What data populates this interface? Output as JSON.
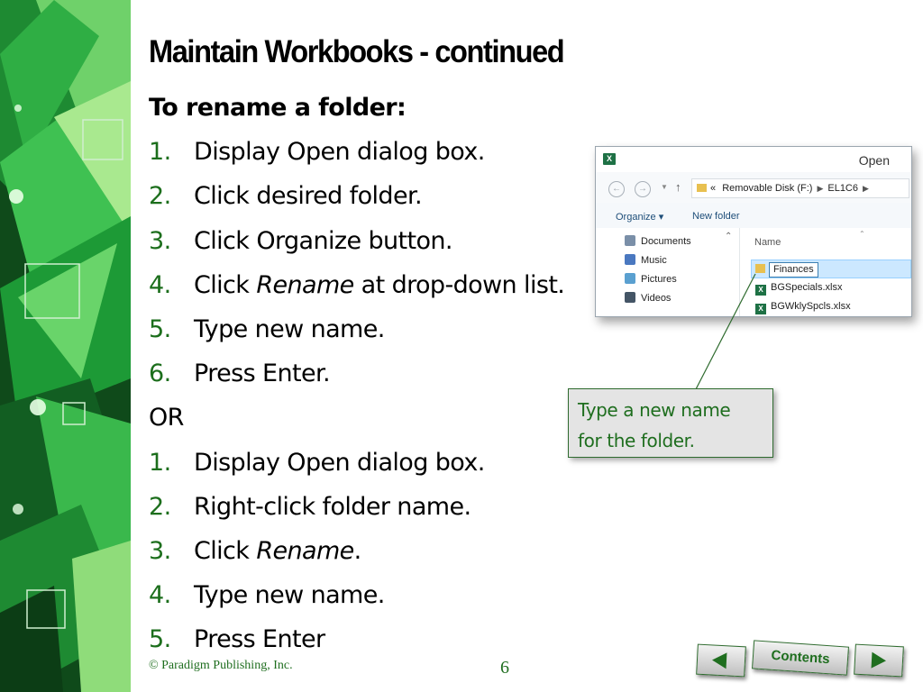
{
  "slide": {
    "title": "Maintain Workbooks - continued",
    "heading": "To rename a folder:",
    "steps_a": [
      {
        "num": "1.",
        "pre": "Display Open dialog box.",
        "em": "",
        "post": ""
      },
      {
        "num": "2.",
        "pre": "Click desired folder.",
        "em": "",
        "post": ""
      },
      {
        "num": "3.",
        "pre": "Click Organize button.",
        "em": "",
        "post": ""
      },
      {
        "num": "4.",
        "pre": "Click ",
        "em": "Rename",
        "post": " at drop-down list."
      },
      {
        "num": "5.",
        "pre": "Type new name.",
        "em": "",
        "post": ""
      },
      {
        "num": "6.",
        "pre": "Press Enter.",
        "em": "",
        "post": ""
      }
    ],
    "or_label": "OR",
    "steps_b": [
      {
        "num": "1.",
        "pre": "Display Open dialog box.",
        "em": "",
        "post": ""
      },
      {
        "num": "2.",
        "pre": "Right-click folder name.",
        "em": "",
        "post": ""
      },
      {
        "num": "3.",
        "pre": "Click ",
        "em": "Rename",
        "post": "."
      },
      {
        "num": "4.",
        "pre": "Type new name.",
        "em": "",
        "post": ""
      },
      {
        "num": "5.",
        "pre": "Press Enter",
        "em": "",
        "post": ""
      }
    ]
  },
  "dialog": {
    "app_icon": "excel-icon",
    "title": "Open",
    "back_icon": "back-arrow-icon",
    "forward_icon": "forward-arrow-icon",
    "dropdown_icon": "chevron-down-icon",
    "up_icon": "up-arrow-icon",
    "address": {
      "prefix": "«",
      "drive": "Removable Disk (F:)",
      "folder": "EL1C6"
    },
    "toolbar": {
      "organize": "Organize ▾",
      "new_folder": "New folder"
    },
    "nav_items": [
      {
        "label": "Documents",
        "icon": "documents-icon",
        "color": "#7a8fa8"
      },
      {
        "label": "Music",
        "icon": "music-icon",
        "color": "#4a78c0"
      },
      {
        "label": "Pictures",
        "icon": "pictures-icon",
        "color": "#5aa0d0"
      },
      {
        "label": "Videos",
        "icon": "videos-icon",
        "color": "#445566"
      }
    ],
    "column_header": "Name",
    "files": {
      "editing_folder": "Finances",
      "items": [
        "BGSpecials.xlsx",
        "BGWklySpcls.xlsx"
      ]
    }
  },
  "callout": {
    "line1": "Type a new name",
    "line2": "for the folder."
  },
  "footer": {
    "copyright": "© Paradigm Publishing, Inc.",
    "page": "6",
    "contents_label": "Contents",
    "prev_icon": "previous-arrow-icon",
    "next_icon": "next-arrow-icon"
  },
  "colors": {
    "accent_green": "#1f6e1f",
    "number_green": "#1c6e1c",
    "selection": "#cce8ff"
  }
}
